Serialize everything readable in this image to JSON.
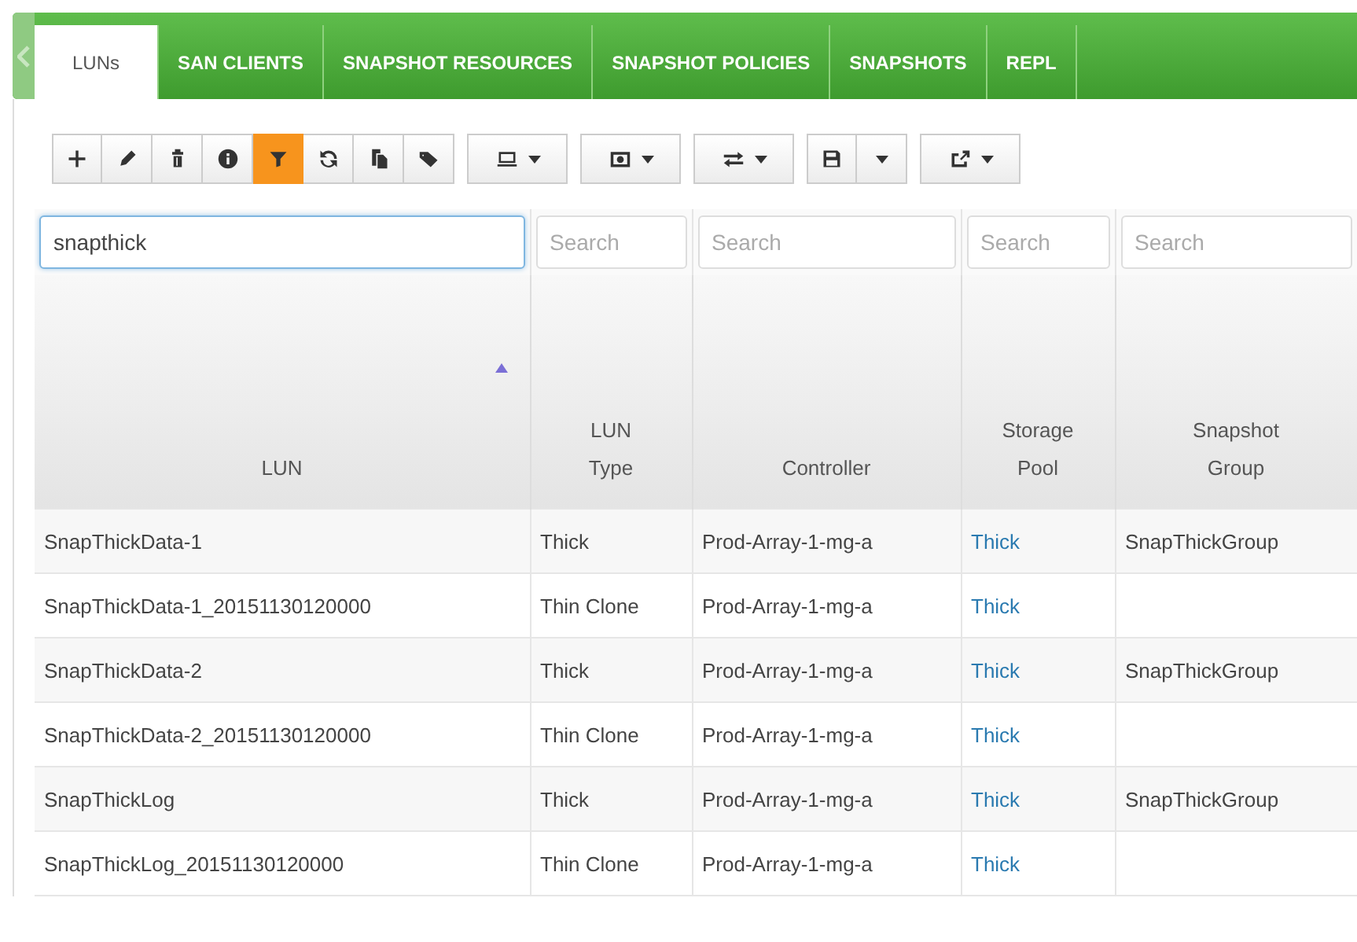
{
  "tabs": [
    {
      "label": "LUNs",
      "selected": true
    },
    {
      "label": "SAN CLIENTS",
      "selected": false
    },
    {
      "label": "SNAPSHOT RESOURCES",
      "selected": false
    },
    {
      "label": "SNAPSHOT POLICIES",
      "selected": false
    },
    {
      "label": "SNAPSHOTS",
      "selected": false
    },
    {
      "label": "REPL",
      "selected": false
    }
  ],
  "toolbar": {
    "buttons": [
      {
        "kind": "add",
        "active": false
      },
      {
        "kind": "edit",
        "active": false
      },
      {
        "kind": "delete",
        "active": false
      },
      {
        "kind": "info",
        "active": false
      },
      {
        "kind": "filter",
        "active": true
      },
      {
        "kind": "refresh",
        "active": false
      },
      {
        "kind": "copy",
        "active": false
      },
      {
        "kind": "tag",
        "active": false
      }
    ],
    "menus": [
      {
        "kind": "monitor"
      },
      {
        "kind": "picture"
      },
      {
        "kind": "transfer"
      },
      {
        "kind": "save"
      },
      {
        "kind": "export"
      }
    ]
  },
  "filters": [
    {
      "value": "snapthick",
      "focused": true
    },
    {
      "placeholder": "Search",
      "focused": false
    },
    {
      "placeholder": "Search",
      "focused": false
    },
    {
      "placeholder": "Search",
      "focused": false
    },
    {
      "placeholder": "Search",
      "focused": false
    }
  ],
  "table": {
    "columns": [
      {
        "title": "LUN",
        "sort_ascending": true,
        "link": false
      },
      {
        "title": "LUN Type",
        "link": false
      },
      {
        "title": "Controller",
        "link": false
      },
      {
        "title": "Storage Pool",
        "link": true
      },
      {
        "title": "Snapshot Group",
        "link": false
      }
    ],
    "rows": [
      [
        "SnapThickData-1",
        "Thick",
        "Prod-Array-1-mg-a",
        "Thick",
        "SnapThickGroup"
      ],
      [
        "SnapThickData-1_20151130120000",
        "Thin Clone",
        "Prod-Array-1-mg-a",
        "Thick",
        ""
      ],
      [
        "SnapThickData-2",
        "Thick",
        "Prod-Array-1-mg-a",
        "Thick",
        "SnapThickGroup"
      ],
      [
        "SnapThickData-2_20151130120000",
        "Thin Clone",
        "Prod-Array-1-mg-a",
        "Thick",
        ""
      ],
      [
        "SnapThickLog",
        "Thick",
        "Prod-Array-1-mg-a",
        "Thick",
        "SnapThickGroup"
      ],
      [
        "SnapThickLog_20151130120000",
        "Thin Clone",
        "Prod-Array-1-mg-a",
        "Thick",
        ""
      ]
    ]
  }
}
